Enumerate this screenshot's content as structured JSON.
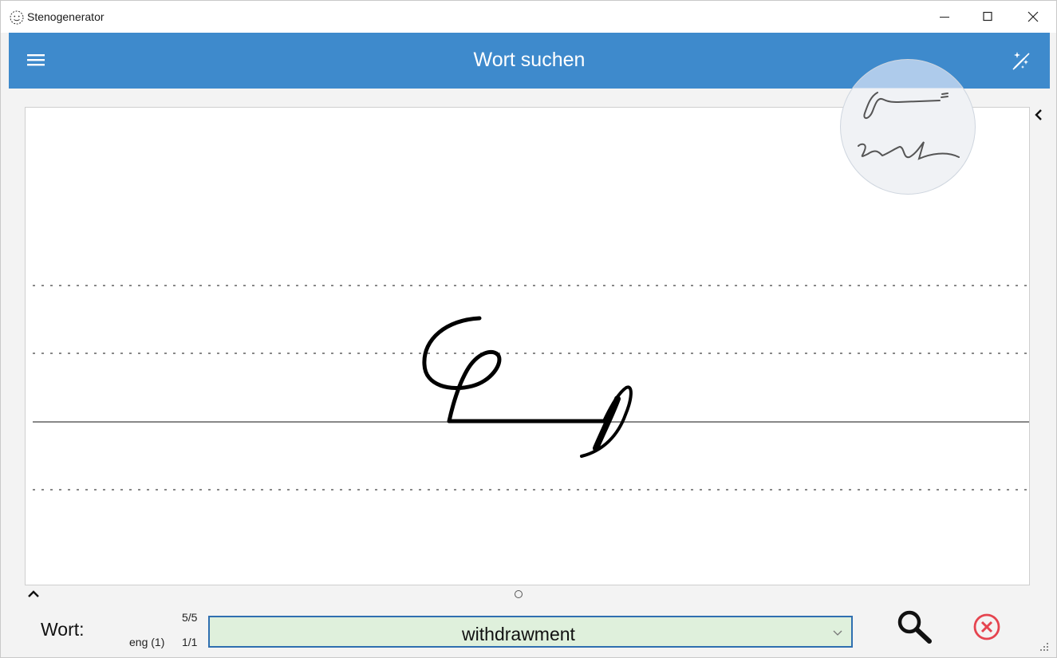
{
  "window": {
    "title": "Stenogenerator",
    "buttons": [
      "minimize",
      "maximize",
      "close"
    ]
  },
  "header": {
    "title": "Wort suchen",
    "bg_color": "#3e8acc",
    "menu_icon": "hamburger-icon",
    "right_icon": "magic-wand-off-icon"
  },
  "search": {
    "label": "Wort:",
    "count": "5/5",
    "language": "eng (1)",
    "lang_count": "1/1",
    "value": "withdrawment",
    "field_color": "#dff0dc",
    "search_icon": "magnifier-icon",
    "cancel_icon": "cancel-circle-icon",
    "cancel_color": "#e5444f"
  },
  "canvas": {
    "guide_lines": [
      "dotted",
      "dotted",
      "baseline",
      "dotted"
    ]
  }
}
